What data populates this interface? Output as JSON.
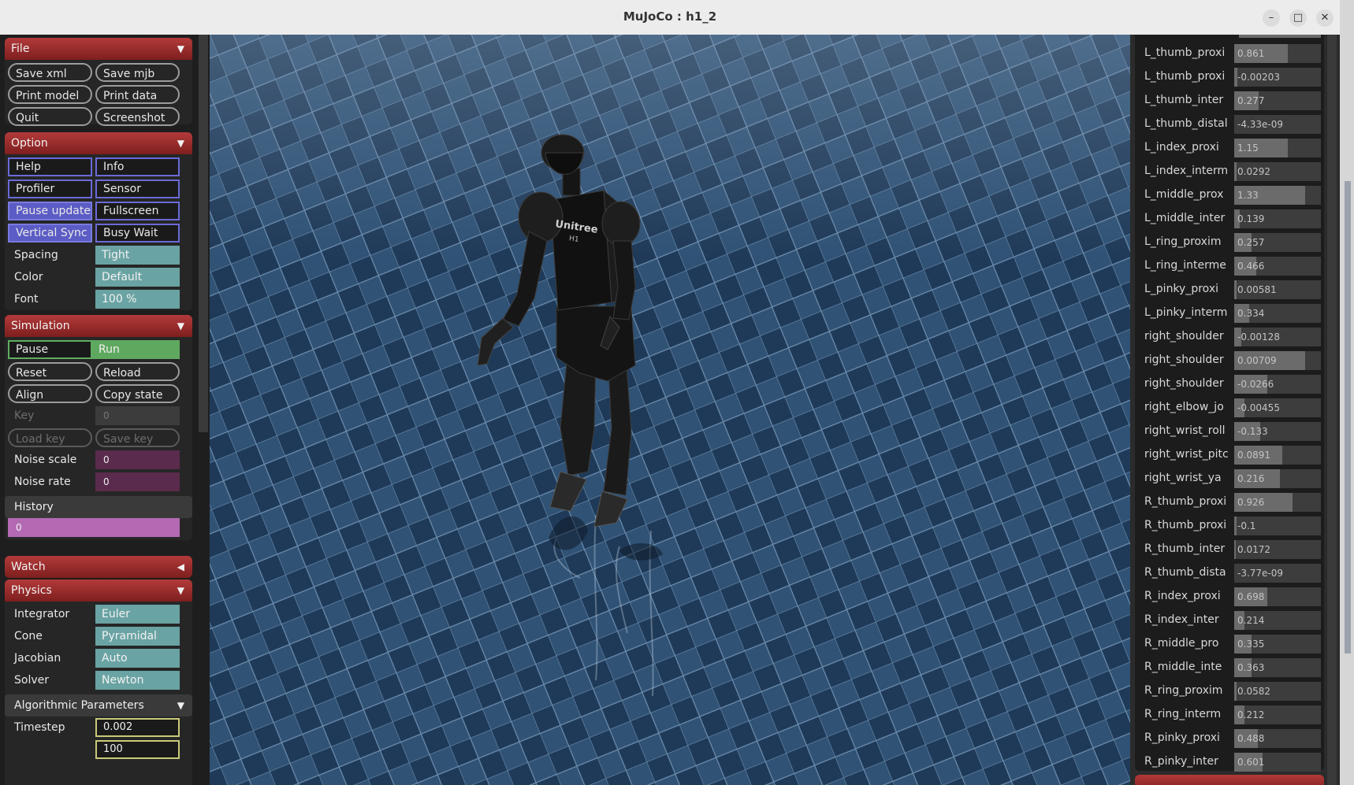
{
  "window": {
    "title": "MuJoCo : h1_2",
    "min_icon": "–",
    "max_icon": "□",
    "close_icon": "✕"
  },
  "robot_label": {
    "brand": "Unitree",
    "model": "H1"
  },
  "file": {
    "header": "File",
    "save_xml": "Save xml",
    "save_mjb": "Save mjb",
    "print_model": "Print model",
    "print_data": "Print data",
    "quit": "Quit",
    "screenshot": "Screenshot"
  },
  "option": {
    "header": "Option",
    "help": "Help",
    "info": "Info",
    "profiler": "Profiler",
    "sensor": "Sensor",
    "pause_update": "Pause update",
    "fullscreen": "Fullscreen",
    "vertical_sync": "Vertical Sync",
    "busy_wait": "Busy Wait",
    "spacing_label": "Spacing",
    "spacing_value": "Tight",
    "color_label": "Color",
    "color_value": "Default",
    "font_label": "Font",
    "font_value": "100 %"
  },
  "simulation": {
    "header": "Simulation",
    "pause": "Pause",
    "run": "Run",
    "reset": "Reset",
    "reload": "Reload",
    "align": "Align",
    "copy_state": "Copy state",
    "key_label": "Key",
    "key_value": "0",
    "load_key": "Load key",
    "save_key": "Save key",
    "noise_scale_label": "Noise scale",
    "noise_scale_value": "0",
    "noise_rate_label": "Noise rate",
    "noise_rate_value": "0",
    "history_label": "History",
    "history_value": "0"
  },
  "watch": {
    "header": "Watch"
  },
  "physics": {
    "header": "Physics",
    "integrator_label": "Integrator",
    "integrator_value": "Euler",
    "cone_label": "Cone",
    "cone_value": "Pyramidal",
    "jacobian_label": "Jacobian",
    "jacobian_value": "Auto",
    "solver_label": "Solver",
    "solver_value": "Newton",
    "algorithmic_parameters": "Algorithmic Parameters",
    "timestep_label": "Timestep",
    "timestep_value": "0.002",
    "iterations_value": "100"
  },
  "joints": [
    {
      "name": "L_thumb_proxi",
      "value": "0.861",
      "fill": 0.62
    },
    {
      "name": "L_thumb_proxi",
      "value": "-0.00203",
      "fill": 0.04
    },
    {
      "name": "L_thumb_inter",
      "value": "0.277",
      "fill": 0.28
    },
    {
      "name": "L_thumb_distal",
      "value": "-4.33e-09",
      "fill": 0.0
    },
    {
      "name": "L_index_proxi",
      "value": "1.15",
      "fill": 0.62
    },
    {
      "name": "L_index_interm",
      "value": "0.0292",
      "fill": 0.03
    },
    {
      "name": "L_middle_prox",
      "value": "1.33",
      "fill": 0.82
    },
    {
      "name": "L_middle_inter",
      "value": "0.139",
      "fill": 0.06
    },
    {
      "name": "L_ring_proxim",
      "value": "0.257",
      "fill": 0.2
    },
    {
      "name": "L_ring_interme",
      "value": "0.466",
      "fill": 0.25
    },
    {
      "name": "L_pinky_proxi",
      "value": "0.00581",
      "fill": 0.03
    },
    {
      "name": "L_pinky_interm",
      "value": "0.334",
      "fill": 0.17
    },
    {
      "name": "right_shoulder",
      "value": "-0.00128",
      "fill": 0.08
    },
    {
      "name": "right_shoulder",
      "value": "0.00709",
      "fill": 0.82
    },
    {
      "name": "right_shoulder",
      "value": "-0.0266",
      "fill": 0.38
    },
    {
      "name": "right_elbow_jo",
      "value": "-0.00455",
      "fill": 0.12
    },
    {
      "name": "right_wrist_roll",
      "value": "-0.133",
      "fill": 0.3
    },
    {
      "name": "right_wrist_pitc",
      "value": "0.0891",
      "fill": 0.55
    },
    {
      "name": "right_wrist_ya",
      "value": "0.216",
      "fill": 0.53
    },
    {
      "name": "R_thumb_proxi",
      "value": "0.926",
      "fill": 0.67
    },
    {
      "name": "R_thumb_proxi",
      "value": "-0.1",
      "fill": 0.03
    },
    {
      "name": "R_thumb_inter",
      "value": "0.0172",
      "fill": 0.02
    },
    {
      "name": "R_thumb_dista",
      "value": "-3.77e-09",
      "fill": 0.0
    },
    {
      "name": "R_index_proxi",
      "value": "0.698",
      "fill": 0.38
    },
    {
      "name": "R_index_inter",
      "value": "0.214",
      "fill": 0.12
    },
    {
      "name": "R_middle_pro",
      "value": "0.335",
      "fill": 0.2
    },
    {
      "name": "R_middle_inte",
      "value": "0.363",
      "fill": 0.2
    },
    {
      "name": "R_ring_proxim",
      "value": "0.0582",
      "fill": 0.03
    },
    {
      "name": "R_ring_interm",
      "value": "0.212",
      "fill": 0.12
    },
    {
      "name": "R_pinky_proxi",
      "value": "0.488",
      "fill": 0.27
    },
    {
      "name": "R_pinky_inter",
      "value": "0.601",
      "fill": 0.33
    }
  ]
}
